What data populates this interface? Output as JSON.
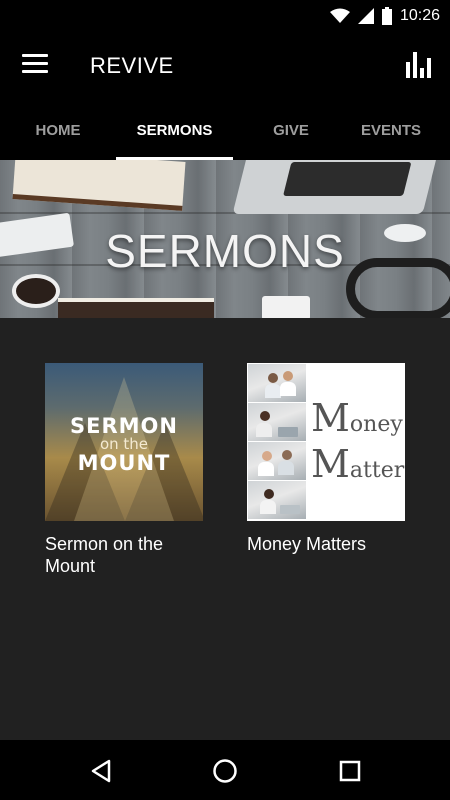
{
  "status_bar": {
    "time": "10:26",
    "icons": [
      "wifi-icon",
      "signal-icon",
      "battery-icon"
    ]
  },
  "app_bar": {
    "title": "REVIVE",
    "menu_icon": "hamburger-menu-icon",
    "action_icon": "bar-chart-icon"
  },
  "tabs": [
    {
      "label": "HOME",
      "active": false
    },
    {
      "label": "SERMONS",
      "active": true
    },
    {
      "label": "GIVE",
      "active": false
    },
    {
      "label": "EVENTS",
      "active": false
    }
  ],
  "banner": {
    "title": "SERMONS"
  },
  "series": [
    {
      "label": "Sermon on the Mount",
      "thumb_text": {
        "line1": "SERMON",
        "line2": "on the",
        "line3": "MOUNT"
      }
    },
    {
      "label": "Money Matters",
      "thumb_text": {
        "m1": "M",
        "rest1": "oney",
        "m2": "M",
        "rest2": "atter$"
      }
    }
  ],
  "nav_bar": {
    "back_icon": "back-triangle-icon",
    "home_icon": "home-circle-icon",
    "recents_icon": "recents-square-icon"
  },
  "colors": {
    "background": "#212121",
    "bar": "#000000",
    "active_tab": "#ffffff",
    "inactive_tab": "#9e9e9e"
  }
}
